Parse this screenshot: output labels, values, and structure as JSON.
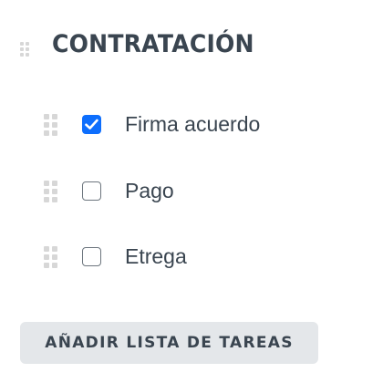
{
  "list": {
    "title": "CONTRATACIÓN",
    "tasks": [
      {
        "label": "Firma acuerdo",
        "checked": true
      },
      {
        "label": "Pago",
        "checked": false
      },
      {
        "label": "Etrega",
        "checked": false
      }
    ]
  },
  "actions": {
    "add_list_label": "AÑADIR LISTA DE TAREAS"
  },
  "colors": {
    "accent": "#0d6efd",
    "text": "#3a4550",
    "grip": "#d7d7d7",
    "button_bg": "#e4e7ea"
  }
}
